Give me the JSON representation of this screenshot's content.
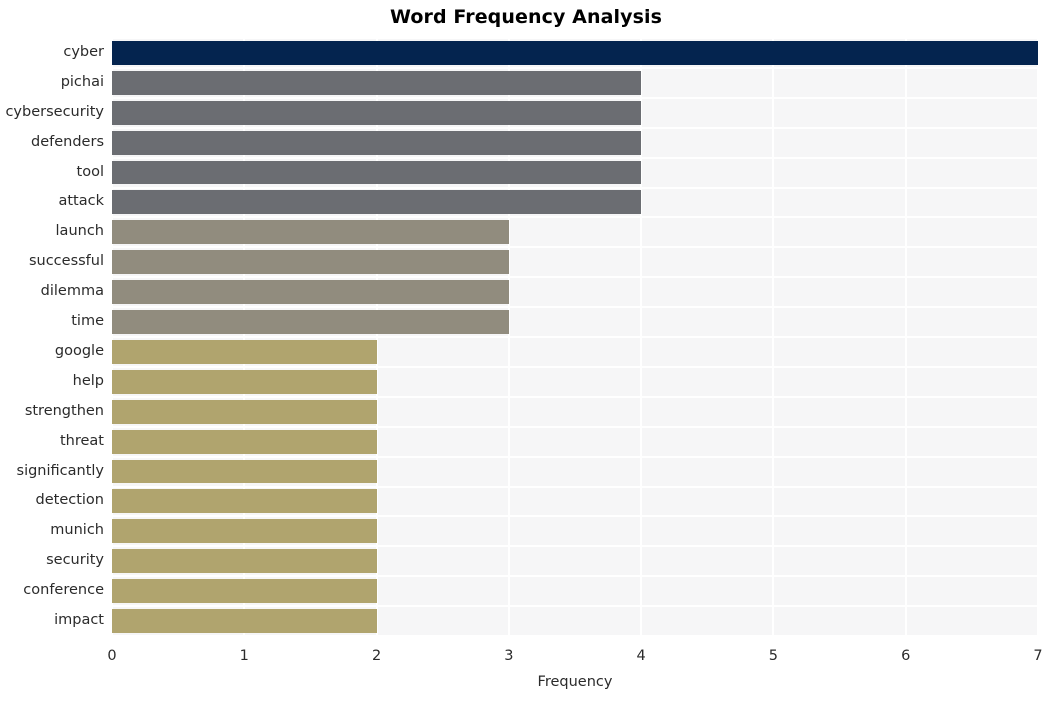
{
  "chart_data": {
    "type": "bar",
    "orientation": "horizontal",
    "title": "Word Frequency Analysis",
    "xlabel": "Frequency",
    "ylabel": "",
    "xlim": [
      0,
      7.0
    ],
    "grid": true,
    "legend": false,
    "categories": [
      "cyber",
      "pichai",
      "cybersecurity",
      "defenders",
      "tool",
      "attack",
      "launch",
      "successful",
      "dilemma",
      "time",
      "google",
      "help",
      "strengthen",
      "threat",
      "significantly",
      "detection",
      "munich",
      "security",
      "conference",
      "impact"
    ],
    "values": [
      7,
      4,
      4,
      4,
      4,
      4,
      3,
      3,
      3,
      3,
      2,
      2,
      2,
      2,
      2,
      2,
      2,
      2,
      2,
      2
    ],
    "bar_colors": [
      "#04244f",
      "#6b6d72",
      "#6b6d72",
      "#6b6d72",
      "#6b6d72",
      "#6b6d72",
      "#918c7e",
      "#918c7e",
      "#918c7e",
      "#918c7e",
      "#b0a46e",
      "#b0a46e",
      "#b0a46e",
      "#b0a46e",
      "#b0a46e",
      "#b0a46e",
      "#b0a46e",
      "#b0a46e",
      "#b0a46e",
      "#b0a46e"
    ],
    "xticks": [
      0,
      1,
      2,
      3,
      4,
      5,
      6,
      7
    ],
    "xticklabels": [
      "0",
      "1",
      "2",
      "3",
      "4",
      "5",
      "6",
      "7"
    ],
    "plot_background": "#f6f6f7",
    "grid_color": "#ffffff",
    "figure_background": "#ffffff",
    "text_color": "#2b2b2b",
    "title_color": "#000000"
  }
}
